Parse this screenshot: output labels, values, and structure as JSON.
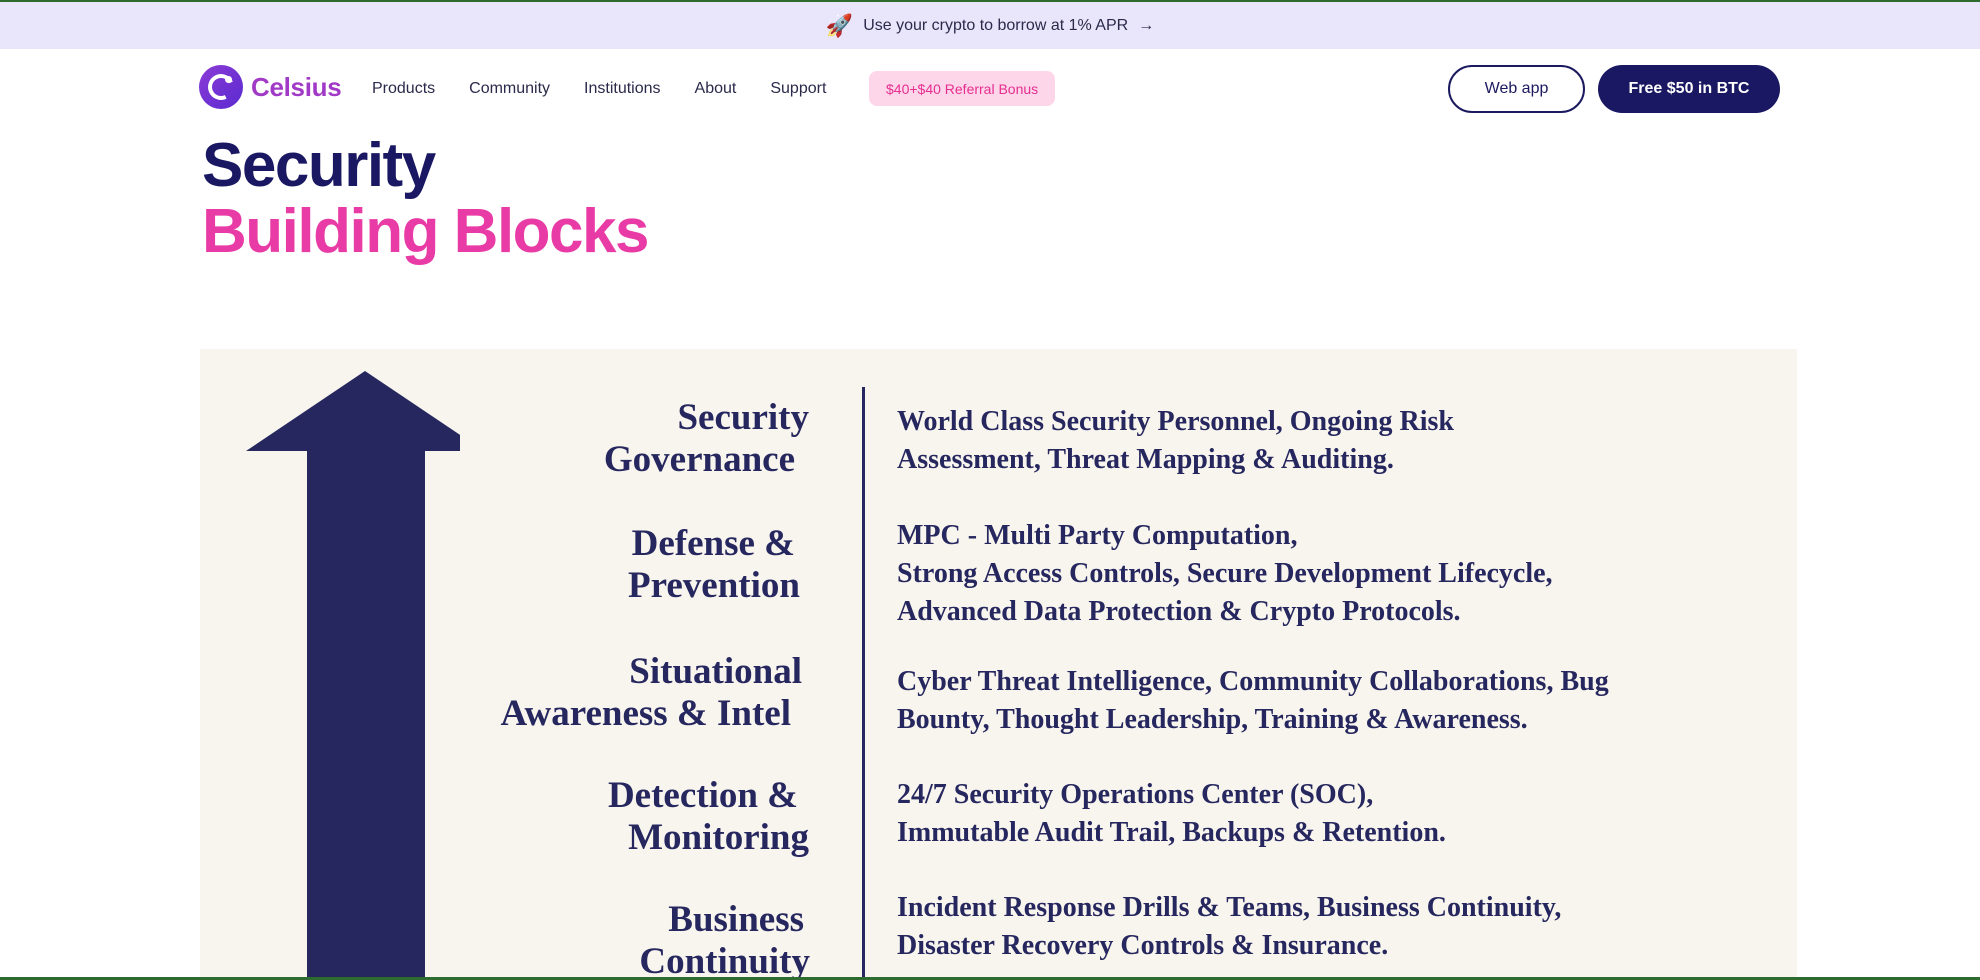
{
  "promo": {
    "icon": "rocket-icon",
    "text": "Use your crypto to borrow at 1% APR",
    "arrow": "→"
  },
  "nav": {
    "logo_text": "Celsius",
    "links": [
      "Products",
      "Community",
      "Institutions",
      "About",
      "Support"
    ],
    "referral": "$40+$40 Referral Bonus",
    "web_app": "Web app",
    "free_btc": "Free $50 in BTC"
  },
  "hero": {
    "line1": "Security",
    "line2": "Building Blocks"
  },
  "blocks": [
    {
      "label": [
        "Security",
        "Governance"
      ],
      "desc": [
        "World Class Security Personnel, Ongoing Risk",
        "Assessment, Threat Mapping & Auditing."
      ]
    },
    {
      "label": [
        "Defense &",
        "Prevention"
      ],
      "desc": [
        "MPC - Multi Party Computation,",
        "Strong Access Controls, Secure Development Lifecycle,",
        "Advanced Data Protection & Crypto Protocols."
      ]
    },
    {
      "label": [
        "Situational",
        "Awareness & Intel"
      ],
      "desc": [
        "Cyber Threat Intelligence, Community Collaborations, Bug",
        "Bounty, Thought Leadership, Training & Awareness."
      ]
    },
    {
      "label": [
        "Detection &",
        "Monitoring"
      ],
      "desc": [
        "24/7 Security Operations Center (SOC),",
        "Immutable Audit Trail, Backups & Retention."
      ]
    },
    {
      "label": [
        "Business",
        "Continuity"
      ],
      "desc": [
        "Incident Response Drills & Teams, Business Continuity,",
        "Disaster Recovery Controls & Insurance."
      ]
    }
  ],
  "colors": {
    "brand_navy": "#1a1862",
    "brand_pink": "#e93ba5",
    "promo_bg": "#e9e5fb",
    "panel_bg": "#f8f5ee"
  }
}
